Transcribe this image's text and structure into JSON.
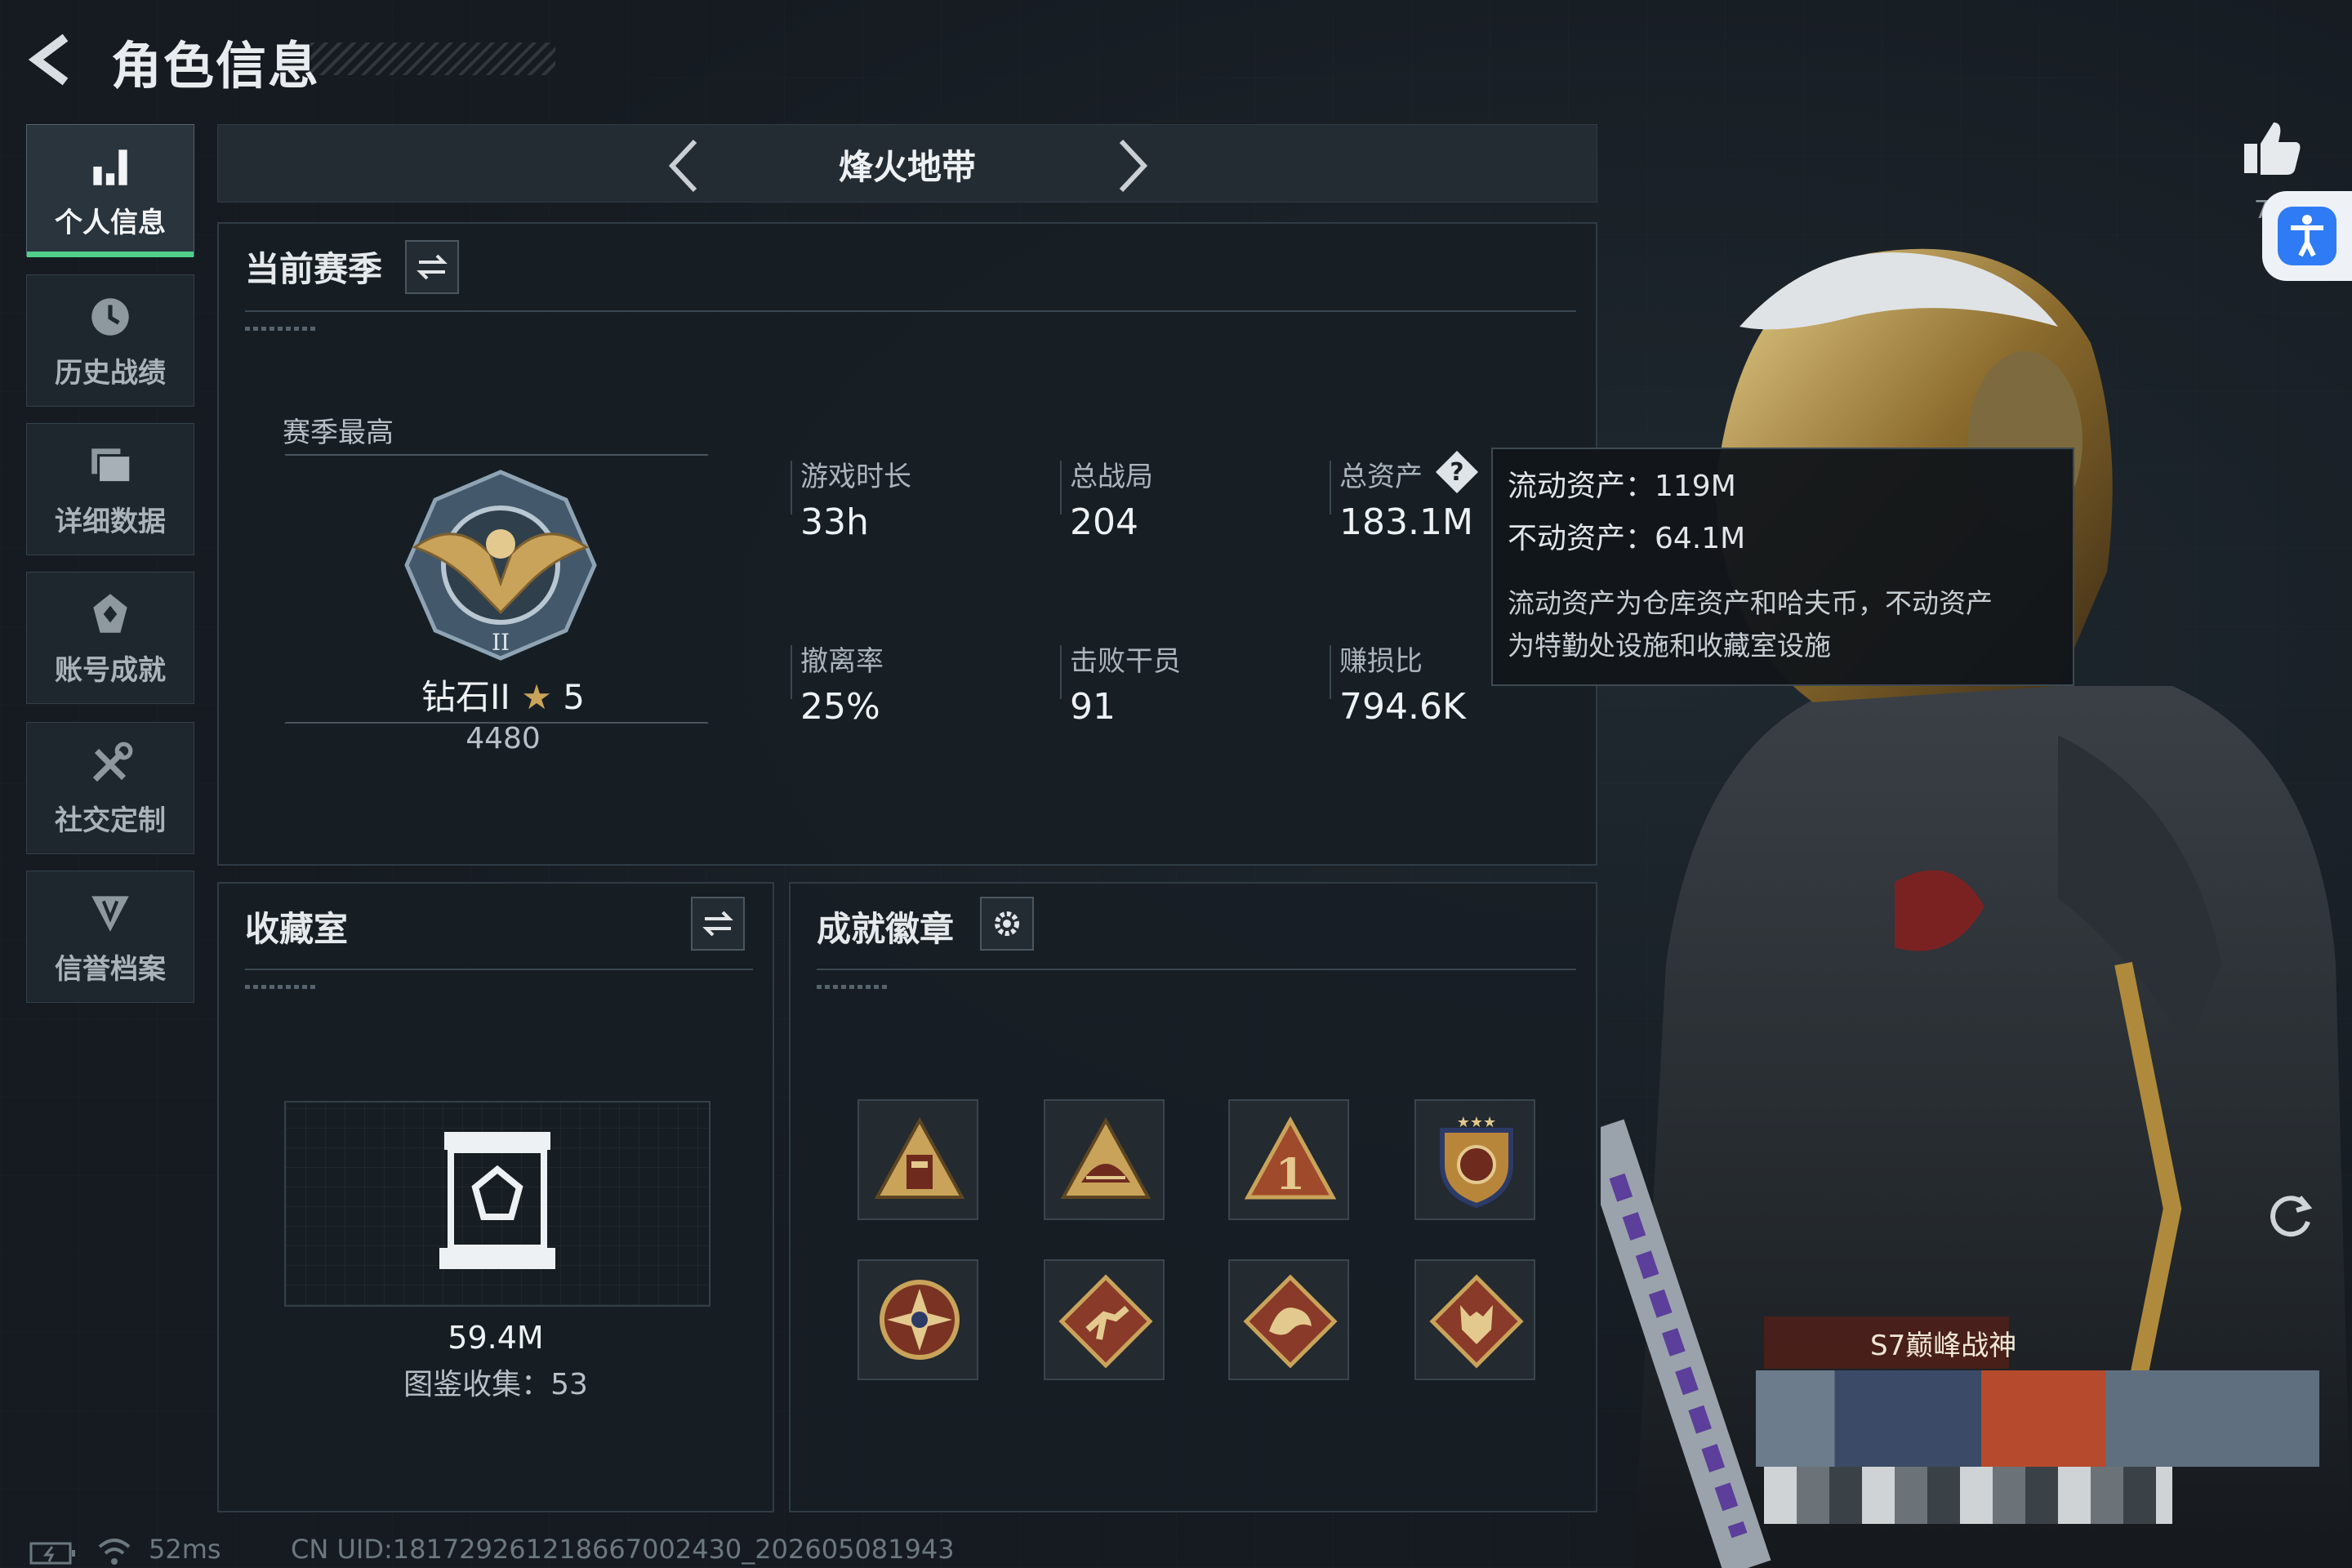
{
  "header": {
    "title": "角色信息"
  },
  "sidebar": {
    "items": [
      {
        "label": "个人信息",
        "active": true,
        "icon": "bar-chart-icon"
      },
      {
        "label": "历史战绩",
        "icon": "clock-history-icon"
      },
      {
        "label": "详细数据",
        "icon": "folder-data-icon"
      },
      {
        "label": "账号成就",
        "icon": "achievement-icon"
      },
      {
        "label": "社交定制",
        "icon": "tools-icon"
      },
      {
        "label": "信誉档案",
        "icon": "credit-shield-icon"
      }
    ]
  },
  "mode": {
    "name": "烽火地带"
  },
  "season": {
    "title": "当前赛季",
    "best_label": "赛季最高",
    "rank_name": "钻石II",
    "rank_stars": "5",
    "rank_points": "4480",
    "stats": [
      {
        "label": "游戏时长",
        "value": "33h"
      },
      {
        "label": "总战局",
        "value": "204"
      },
      {
        "label": "总资产",
        "value": "183.1M"
      },
      {
        "label": "撤离率",
        "value": "25%"
      },
      {
        "label": "击败干员",
        "value": "91"
      },
      {
        "label": "赚损比",
        "value": "794.6K"
      }
    ]
  },
  "tooltip": {
    "liquid": "流动资产：119M",
    "fixed": "不动资产：64.1M",
    "desc1": "流动资产为仓库资产和哈夫币，不动资产",
    "desc2": "为特勤处设施和收藏室设施"
  },
  "collection": {
    "title": "收藏室",
    "value": "59.4M",
    "catalog": "图鉴收集：53"
  },
  "achievements": {
    "title": "成就徽章"
  },
  "showcase": {
    "title": "S7巅峰战神",
    "like_count": "7"
  },
  "footer": {
    "ping": "52ms",
    "uid": "CN UID:1817292612186670024​30_202605081943"
  },
  "colors": {
    "accent": "#4fd08a",
    "gold": "#c9a35a",
    "bg": "#151b21",
    "access_blue": "#2f7bf5"
  }
}
